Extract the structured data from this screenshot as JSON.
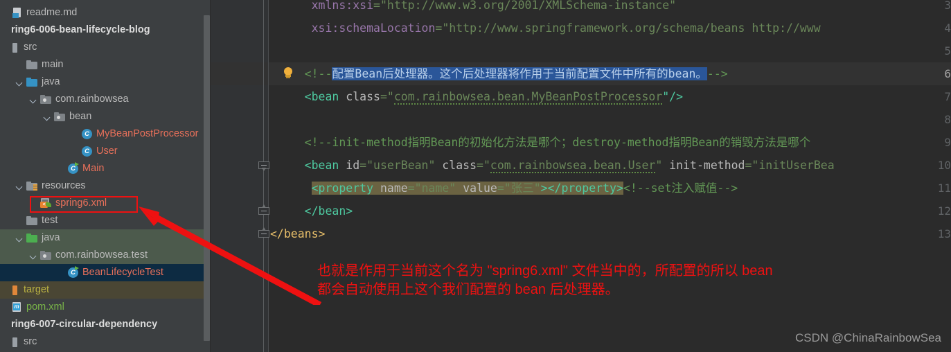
{
  "sidebar": {
    "scrollbar": "vertical-scrollbar",
    "items": [
      {
        "label": "readme.md",
        "icon": "markdown-file-icon",
        "indent": 0,
        "twisty": "",
        "style": "md",
        "name": "tree-item-readme-md"
      },
      {
        "label": "ring6-006-bean-lifecycle-blog",
        "icon": "module-icon",
        "indent": 0,
        "twisty": "",
        "style": "module",
        "name": "tree-item-module-spring6-006"
      },
      {
        "label": "src",
        "icon": "source-root-icon",
        "indent": 0,
        "twisty": "",
        "style": "plain",
        "name": "tree-item-src"
      },
      {
        "label": "main",
        "icon": "folder-icon",
        "indent": 1,
        "twisty": "",
        "style": "plain",
        "name": "tree-item-main"
      },
      {
        "label": "java",
        "icon": "folder-blue-icon",
        "indent": 1,
        "twisty": "open",
        "style": "plain",
        "name": "tree-item-java-main"
      },
      {
        "label": "com.rainbowsea",
        "icon": "package-icon",
        "indent": 2,
        "twisty": "open",
        "style": "plain",
        "name": "tree-item-package-com-rainbowsea"
      },
      {
        "label": "bean",
        "icon": "package-icon",
        "indent": 3,
        "twisty": "open",
        "style": "plain",
        "name": "tree-item-package-bean"
      },
      {
        "label": "MyBeanPostProcessor",
        "icon": "java-class-icon",
        "indent": 5,
        "twisty": "",
        "style": "class",
        "name": "tree-item-class-mybeanpostprocessor"
      },
      {
        "label": "User",
        "icon": "java-class-icon",
        "indent": 5,
        "twisty": "",
        "style": "class",
        "name": "tree-item-class-user"
      },
      {
        "label": "Main",
        "icon": "java-class-runnable-icon",
        "indent": 4,
        "twisty": "",
        "style": "class",
        "name": "tree-item-class-main"
      },
      {
        "label": "resources",
        "icon": "resources-folder-icon",
        "indent": 1,
        "twisty": "open",
        "style": "plain",
        "name": "tree-item-resources"
      },
      {
        "label": "spring6.xml",
        "icon": "spring-xml-file-icon",
        "indent": 2,
        "twisty": "",
        "style": "xml",
        "name": "tree-item-spring6-xml"
      },
      {
        "label": "test",
        "icon": "folder-icon",
        "indent": 1,
        "twisty": "",
        "style": "plain",
        "name": "tree-item-test"
      },
      {
        "label": "java",
        "icon": "folder-green-icon",
        "indent": 1,
        "twisty": "open",
        "style": "plain",
        "name": "tree-item-java-test",
        "rowbg": "green"
      },
      {
        "label": "com.rainbowsea.test",
        "icon": "package-icon",
        "indent": 2,
        "twisty": "open",
        "style": "plain",
        "name": "tree-item-package-com-rainbowsea-test",
        "rowbg": "green"
      },
      {
        "label": "BeanLifecycleTest",
        "icon": "java-class-runnable-icon",
        "indent": 4,
        "twisty": "",
        "style": "class",
        "name": "tree-item-class-beanlifecycletest",
        "rowbg": "sel"
      },
      {
        "label": "target",
        "icon": "target-folder-icon",
        "indent": 0,
        "twisty": "",
        "style": "olive",
        "name": "tree-item-target",
        "rowbg": "olive"
      },
      {
        "label": "pom.xml",
        "icon": "maven-pom-icon",
        "indent": 0,
        "twisty": "",
        "style": "pom",
        "name": "tree-item-pom-xml"
      },
      {
        "label": "ring6-007-circular-dependency",
        "icon": "module-icon",
        "indent": 0,
        "twisty": "",
        "style": "module",
        "name": "tree-item-module-spring6-007"
      },
      {
        "label": "src",
        "icon": "source-root-icon",
        "indent": 0,
        "twisty": "",
        "style": "plain",
        "name": "tree-item-src-2"
      }
    ]
  },
  "editor": {
    "file": "spring6.xml",
    "line_numbers": [
      "3",
      "4",
      "5",
      "6",
      "7",
      "8",
      "9",
      "10",
      "11",
      "12",
      "13"
    ],
    "current_line": "6",
    "lines": {
      "l3_attr": "xmlns:xsi",
      "l3_value": "=\"http://www.w3.org/2001/XMLSchema-instance\"",
      "l4_attr": "xsi:schemaLocation",
      "l4_value": "=\"http://www.springframework.org/schema/beans http://www",
      "l6_open": "<!--",
      "l6_comment": "配置Bean后处理器。这个后处理器将作用于当前配置文件中所有的bean。",
      "l6_close": "-->",
      "l7_tag_open": "<bean ",
      "l7_attr": "class",
      "l7_eq": "=\"",
      "l7_val": "com.rainbowsea.bean.MyBeanPostProcessor",
      "l7_tail": "\"/>",
      "l9_comment": "<!--init-method指明Bean的初始化方法是哪个；destroy-method指明Bean的销毁方法是哪个",
      "l10_tag_open": "<bean ",
      "l10_attr1": "id",
      "l10_val1": "=\"userBean\" ",
      "l10_attr2": "class",
      "l10_eq2": "=\"",
      "l10_val2": "com.rainbowsea.bean.User",
      "l10_q2": "\" ",
      "l10_attr3": "init-method",
      "l10_val3": "=\"initUserBea",
      "l11_tag": "<property ",
      "l11_attr1": "name",
      "l11_val1": "=\"name\" ",
      "l11_attr2": "value",
      "l11_val2": "=\"张三\"",
      "l11_close": "></property>",
      "l11_comment": "<!--set注入赋值-->",
      "l12": "</bean>",
      "l13": "</beans>"
    },
    "gutter_icons": {
      "intention_bulb": "lightbulb-icon",
      "fold_markers": [
        "fold-down-icon",
        "fold-up-icon",
        "fold-up-icon"
      ]
    }
  },
  "annotation": {
    "highlight_box_target": "spring6.xml",
    "arrow": "red-arrow",
    "note_line1": "也就是作用于当前这个名为 \"spring6.xml\" 文件当中的，所配置的所以 bean",
    "note_line2": "都会自动使用上这个我们配置的 bean 后处理器。",
    "note_color": "#ee1111"
  },
  "watermark": {
    "text": "CSDN @ChinaRainbowSea"
  }
}
